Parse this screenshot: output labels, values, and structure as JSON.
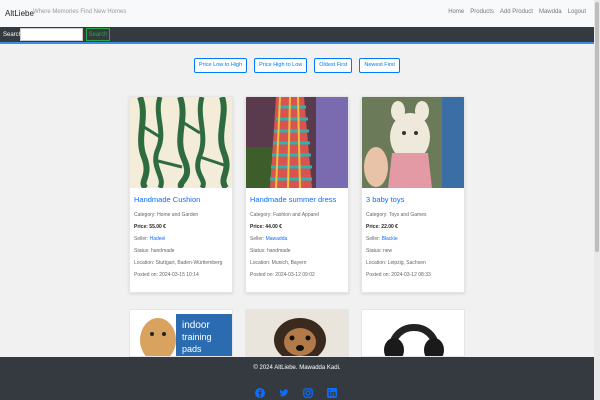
{
  "nav": {
    "brand": "AltLiebe",
    "tagline": "Where Memories Find New Homes",
    "links": [
      "Home",
      "Products",
      "Add Product",
      "Mawdda",
      "Logout"
    ]
  },
  "search": {
    "label": "Search",
    "button": "Search"
  },
  "sort": [
    "Price Low to High",
    "Price High to Low",
    "Oldest First",
    "Newest First"
  ],
  "products": [
    {
      "title": "Handmade Cushion",
      "category": "Category: Home and Garden",
      "price": "Price: 55.00 €",
      "seller_label": "Seller:",
      "seller": "Hadeel",
      "status": "Status: handmade",
      "location": "Location: Stuttgart, Baden-Württemberg",
      "posted": "Posted on: 2024-03-15 10:14"
    },
    {
      "title": "Handmade summer dress",
      "category": "Category: Fashion and Apparel",
      "price": "Price: 44.00 €",
      "seller_label": "Seller:",
      "seller": "Mawadda",
      "status": "Status: handmade",
      "location": "Location: Munich, Bayern",
      "posted": "Posted on: 2024-03-12 09:02"
    },
    {
      "title": "3 baby toys",
      "category": "Category: Toys and Games",
      "price": "Price: 22.00 €",
      "seller_label": "Seller:",
      "seller": "Blackie",
      "status": "Status: new",
      "location": "Location: Leipzig, Sachsen",
      "posted": "Posted on: 2024-03-12 08:33"
    }
  ],
  "second_row_images": [
    "dog-pads-image",
    "dog-image",
    "headphones-image"
  ],
  "dog_pads_text": {
    "line1": "indoor",
    "line2": "training",
    "line3": "pads"
  },
  "footer": {
    "text": "© 2024 AltLiebe. Mawadda Kadi.",
    "icons": [
      "facebook-icon",
      "twitter-icon",
      "instagram-icon",
      "linkedin-icon"
    ]
  },
  "colors": {
    "accent": "#0d6efd",
    "dark": "#343a40",
    "success": "#28a745"
  }
}
